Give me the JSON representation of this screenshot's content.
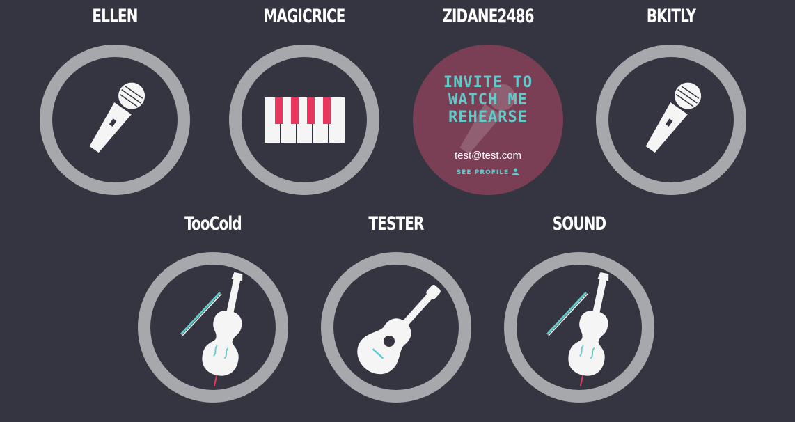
{
  "colors": {
    "background": "#343540",
    "ring": "#a7a8ac",
    "icon": "#f5f5f5",
    "accent_pink": "#e8365f",
    "accent_teal": "#63c9c9",
    "hover_overlay": "#7a3f55"
  },
  "members": [
    {
      "name": "ELLEN",
      "instrument": "microphone-icon"
    },
    {
      "name": "MAGICRICE",
      "instrument": "piano-keys-icon"
    },
    {
      "name": "ZIDANE2486",
      "instrument": "microphone-icon",
      "hover_card": {
        "invite_label": "INVITE TO WATCH ME REHEARSE",
        "email": "test@test.com",
        "see_profile_label": "SEE PROFILE",
        "profile_icon": "user-icon"
      }
    },
    {
      "name": "BKITLY",
      "instrument": "microphone-icon"
    },
    {
      "name": "TooCold",
      "instrument": "violin-icon"
    },
    {
      "name": "TESTER",
      "instrument": "guitar-icon"
    },
    {
      "name": "SOUND",
      "instrument": "violin-icon"
    }
  ]
}
